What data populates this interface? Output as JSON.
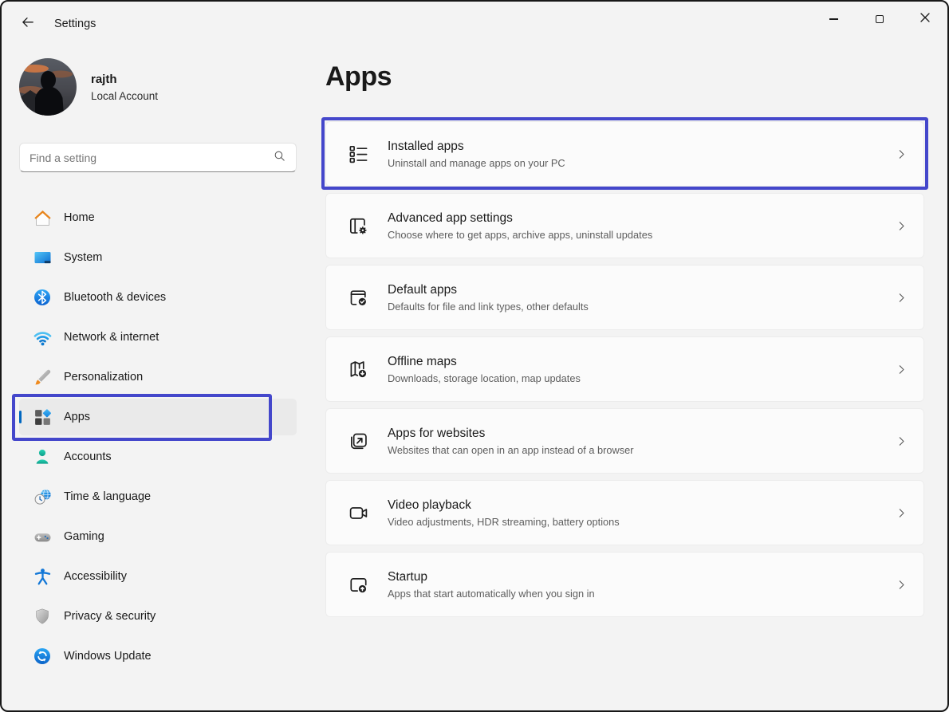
{
  "titlebar": {
    "title": "Settings",
    "back_icon": "back-arrow-icon",
    "controls": {
      "minimize": "minimize",
      "maximize": "maximize",
      "close": "close"
    }
  },
  "profile": {
    "name": "rajth",
    "account_type": "Local Account",
    "avatar": "user-photo-sunset-silhouette"
  },
  "search": {
    "placeholder": "Find a setting",
    "icon": "search-icon"
  },
  "sidebar": {
    "items": [
      {
        "label": "Home",
        "icon": "home-icon",
        "selected": false
      },
      {
        "label": "System",
        "icon": "system-icon",
        "selected": false
      },
      {
        "label": "Bluetooth & devices",
        "icon": "bluetooth-icon",
        "selected": false
      },
      {
        "label": "Network & internet",
        "icon": "network-icon",
        "selected": false
      },
      {
        "label": "Personalization",
        "icon": "personalization-icon",
        "selected": false
      },
      {
        "label": "Apps",
        "icon": "apps-icon",
        "selected": true
      },
      {
        "label": "Accounts",
        "icon": "accounts-icon",
        "selected": false
      },
      {
        "label": "Time & language",
        "icon": "time-language-icon",
        "selected": false
      },
      {
        "label": "Gaming",
        "icon": "gaming-icon",
        "selected": false
      },
      {
        "label": "Accessibility",
        "icon": "accessibility-icon",
        "selected": false
      },
      {
        "label": "Privacy & security",
        "icon": "privacy-security-icon",
        "selected": false
      },
      {
        "label": "Windows Update",
        "icon": "windows-update-icon",
        "selected": false
      }
    ]
  },
  "main": {
    "title": "Apps",
    "cards": [
      {
        "title": "Installed apps",
        "subtitle": "Uninstall and manage apps on your PC",
        "icon": "installed-apps-icon"
      },
      {
        "title": "Advanced app settings",
        "subtitle": "Choose where to get apps, archive apps, uninstall updates",
        "icon": "advanced-app-settings-icon"
      },
      {
        "title": "Default apps",
        "subtitle": "Defaults for file and link types, other defaults",
        "icon": "default-apps-icon"
      },
      {
        "title": "Offline maps",
        "subtitle": "Downloads, storage location, map updates",
        "icon": "offline-maps-icon"
      },
      {
        "title": "Apps for websites",
        "subtitle": "Websites that can open in an app instead of a browser",
        "icon": "apps-for-websites-icon"
      },
      {
        "title": "Video playback",
        "subtitle": "Video adjustments, HDR streaming, battery options",
        "icon": "video-playback-icon"
      },
      {
        "title": "Startup",
        "subtitle": "Apps that start automatically when you sign in",
        "icon": "startup-icon"
      }
    ]
  },
  "annotations": {
    "highlighted_card": "Installed apps",
    "highlighted_nav_item": "Apps",
    "color": "#4447cb"
  },
  "colors": {
    "accent": "#0067c0",
    "annotation": "#4447cb",
    "window_background": "#f3f3f3",
    "card_background": "#fbfbfb",
    "selected_nav_background": "#eaeaea"
  }
}
